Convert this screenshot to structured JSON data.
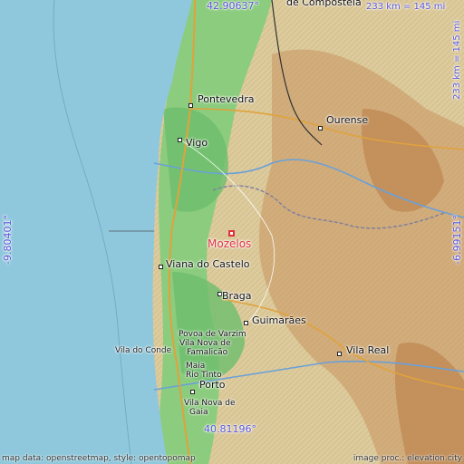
{
  "map": {
    "place": "Mozelos",
    "coords": {
      "top_lat": "42.90637°",
      "bottom_lat": "40.81196°",
      "left_lon": "-9.80401°",
      "right_lon": "-6.99151°"
    },
    "scale": {
      "horizontal": "233 km = 145 mi",
      "vertical": "233 km = 145 mi"
    },
    "cities": [
      {
        "id": "santiago",
        "label": "de Compostela"
      },
      {
        "id": "pontevedra",
        "label": "Pontevedra"
      },
      {
        "id": "ourense",
        "label": "Ourense"
      },
      {
        "id": "vigo",
        "label": "Vigo"
      },
      {
        "id": "viana",
        "label": "Viana do Castelo"
      },
      {
        "id": "braga",
        "label": "Braga"
      },
      {
        "id": "guimaraes",
        "label": "Guimarães"
      },
      {
        "id": "povoa",
        "label": "Povoa de Varzim"
      },
      {
        "id": "famalicao1",
        "label": "Vila Nova de"
      },
      {
        "id": "famalicao2",
        "label": "Famalicão"
      },
      {
        "id": "vilaconde",
        "label": "Vila do Conde"
      },
      {
        "id": "maia",
        "label": "Maia"
      },
      {
        "id": "riotinto",
        "label": "Rio Tinto"
      },
      {
        "id": "porto",
        "label": "Porto"
      },
      {
        "id": "gaia1",
        "label": "Vila Nova de"
      },
      {
        "id": "gaia2",
        "label": "Gaia"
      },
      {
        "id": "vilareal",
        "label": "Vila Real"
      }
    ],
    "credits": {
      "left": "map data: openstreetmap, style: opentopomap",
      "right": "image proc.: elevation.city"
    },
    "colors": {
      "sea": "#8fc8dc",
      "lowland": "#6dbe6d",
      "upland": "#d8c79a",
      "highland": "#c99a68",
      "coordinate_text": "#5a55d8",
      "marker": "#e0313e"
    }
  }
}
